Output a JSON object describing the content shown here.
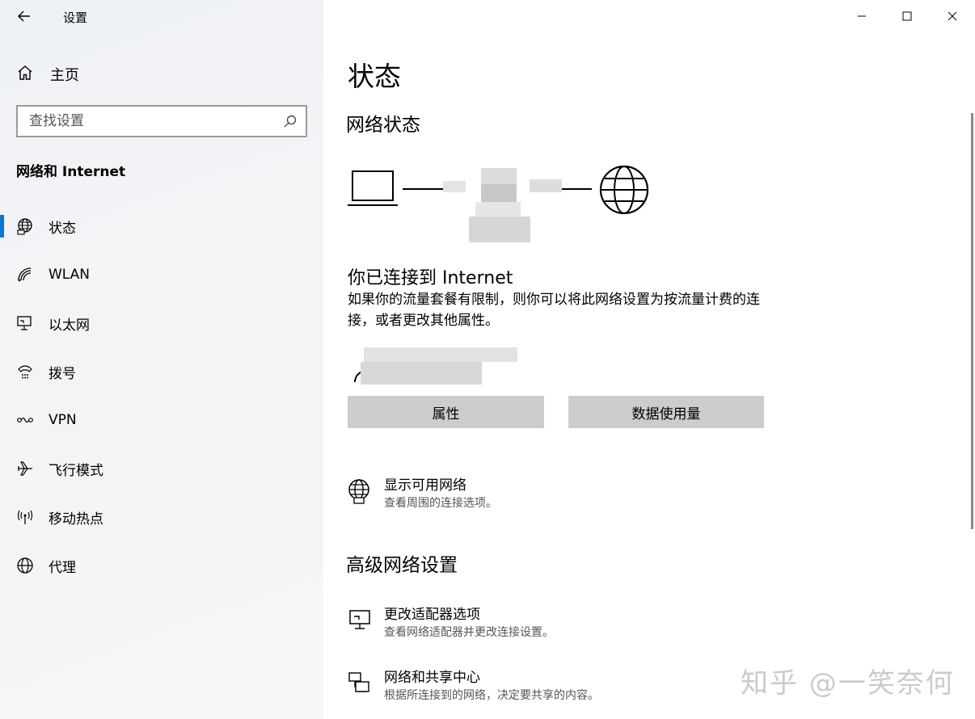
{
  "window": {
    "title": "设置"
  },
  "sidebar": {
    "home_label": "主页",
    "search_placeholder": "查找设置",
    "section_title": "网络和 Internet",
    "items": [
      {
        "label": "状态",
        "icon": "globe-status-icon",
        "active": true
      },
      {
        "label": "WLAN",
        "icon": "wifi-icon"
      },
      {
        "label": "以太网",
        "icon": "ethernet-icon"
      },
      {
        "label": "拨号",
        "icon": "dialup-icon"
      },
      {
        "label": "VPN",
        "icon": "vpn-icon"
      },
      {
        "label": "飞行模式",
        "icon": "airplane-icon"
      },
      {
        "label": "移动热点",
        "icon": "hotspot-icon"
      },
      {
        "label": "代理",
        "icon": "globe-icon"
      }
    ]
  },
  "main": {
    "page_title": "状态",
    "network_status_heading": "网络状态",
    "connected_title": "你已连接到 Internet",
    "connected_desc": "如果你的流量套餐有限制，则你可以将此网络设置为按流量计费的连接，或者更改其他属性。",
    "buttons": {
      "properties": "属性",
      "data_usage": "数据使用量"
    },
    "show_networks": {
      "title": "显示可用网络",
      "desc": "查看周围的连接选项。"
    },
    "advanced_heading": "高级网络设置",
    "adapter_options": {
      "title": "更改适配器选项",
      "desc": "查看网络适配器并更改连接设置。"
    },
    "sharing_center": {
      "title": "网络和共享中心",
      "desc": "根据所连接到的网络，决定要共享的内容。"
    }
  },
  "watermark": "知乎 @一笑奈何",
  "colors": {
    "accent": "#0078d7",
    "button_bg": "#cccccc"
  }
}
